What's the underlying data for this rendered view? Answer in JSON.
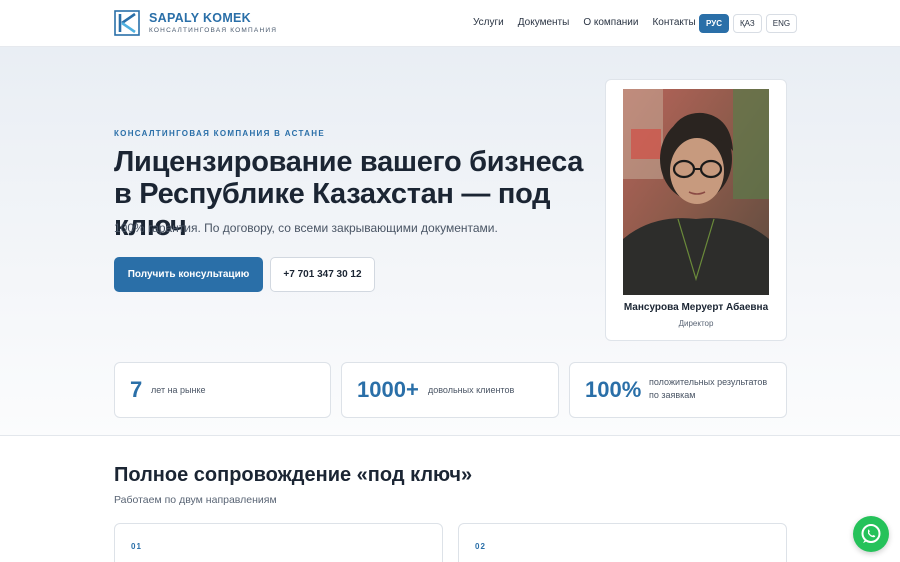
{
  "header": {
    "logo_name": "SAPALY KOMEK",
    "logo_sub": "КОНСАЛТИНГОВАЯ КОМПАНИЯ",
    "nav": [
      "Услуги",
      "Документы",
      "О компании",
      "Контакты"
    ],
    "langs": [
      {
        "label": "РУС",
        "active": true
      },
      {
        "label": "ҚАЗ",
        "active": false
      },
      {
        "label": "ENG",
        "active": false
      }
    ]
  },
  "hero": {
    "eyebrow": "КОНСАЛТИНГОВАЯ КОМПАНИЯ В АСТАНЕ",
    "title": "Лицензирование вашего бизнеса в Республике Казахстан — под ключ",
    "subtitle": "100% гарантия. По договору, со всеми закрывающими документами.",
    "cta_label": "Получить консультацию",
    "phone_label": "+7 701 347 30 12"
  },
  "director": {
    "name": "Мансурова Меруерт Абаевна",
    "role": "Директор"
  },
  "stats": [
    {
      "value": "7",
      "label": "лет на рынке"
    },
    {
      "value": "1000+",
      "label": "довольных клиентов"
    },
    {
      "value": "100%",
      "label": "положительных результатов по заявкам"
    }
  ],
  "section": {
    "title": "Полное сопровождение «под ключ»",
    "subtitle": "Работаем по двум направлениям",
    "cards": [
      {
        "num": "01"
      },
      {
        "num": "02"
      }
    ]
  },
  "colors": {
    "brand": "#2a6fa8",
    "whatsapp": "#25c25a"
  },
  "icons": {
    "logo": "logo-mark-icon",
    "whatsapp": "whatsapp-icon"
  }
}
